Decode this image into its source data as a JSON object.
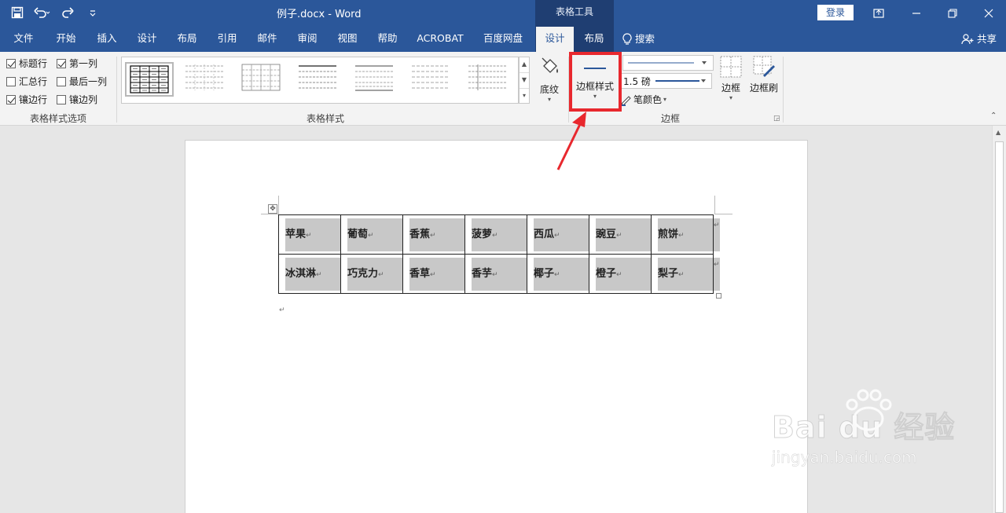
{
  "titlebar": {
    "doc_title": "例子.docx  -  Word",
    "context_tools": "表格工具",
    "login": "登录"
  },
  "tabs": [
    "文件",
    "开始",
    "插入",
    "设计",
    "布局",
    "引用",
    "邮件",
    "审阅",
    "视图",
    "帮助",
    "ACROBAT",
    "百度网盘"
  ],
  "context_tabs": [
    "设计",
    "布局"
  ],
  "search": "搜索",
  "share": "共享",
  "ribbon": {
    "style_options": {
      "items": [
        "标题行",
        "第一列",
        "汇总行",
        "最后一列",
        "镶边行",
        "镶边列"
      ],
      "checked": [
        true,
        true,
        false,
        false,
        true,
        false
      ],
      "label": "表格样式选项"
    },
    "table_styles_label": "表格样式",
    "shading": "底纹",
    "border_styles": "边框样式",
    "pen_weight": "1.5 磅",
    "pen_color": "笔颜色",
    "borders": "边框",
    "border_painter": "边框刷",
    "borders_group_label": "边框"
  },
  "table": {
    "rows": [
      [
        "苹果",
        "葡萄",
        "香蕉",
        "菠萝",
        "西瓜",
        "豌豆",
        "煎饼"
      ],
      [
        "冰淇淋",
        "巧克力",
        "香草",
        "香芋",
        "椰子",
        "橙子",
        "梨子"
      ]
    ]
  },
  "watermark": {
    "brand": "Bai du 经验",
    "url": "jingyan.baidu.com"
  },
  "colors": {
    "title_blue": "#2b579a",
    "context_blue": "#1f3e72",
    "highlight_red": "#e8282e",
    "cell_shade": "#c8c8c8"
  }
}
